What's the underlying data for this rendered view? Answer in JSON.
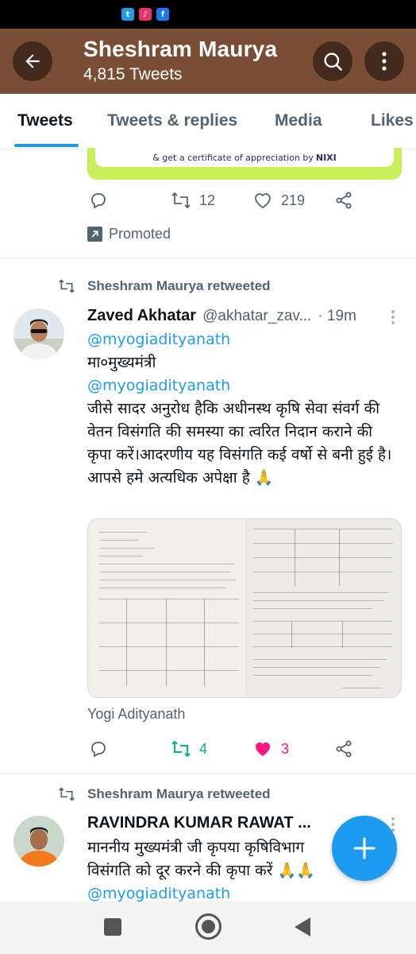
{
  "status_bar": {
    "icons": [
      "twitter-icon",
      "tiktok-icon",
      "facebook-icon"
    ]
  },
  "header": {
    "name": "Sheshram Maurya",
    "tweet_count": "4,815 Tweets",
    "color": "#7a4e35"
  },
  "tabs": [
    {
      "label": "Tweets",
      "active": true
    },
    {
      "label": "Tweets & replies",
      "active": false
    },
    {
      "label": "Media",
      "active": false
    },
    {
      "label": "Likes",
      "active": false
    }
  ],
  "promoted_tweet": {
    "card_text": "& get a certificate of appreciation by",
    "card_brand": "NIXI",
    "retweets": "12",
    "likes": "219",
    "promoted_label": "Promoted"
  },
  "tweet1": {
    "retweeted_by": "Sheshram Maurya retweeted",
    "name": "Zaved Akhatar",
    "handle": "@akhatar_zav...",
    "time": "· 19m",
    "mention1": "@myogiadityanath",
    "line1": "मा०मुख्यमंत्री",
    "mention2": "@myogiadityanath",
    "text": "जीसे सादर अनुरोध हैकि अधीनस्थ कृषि सेवा संवर्ग की वेतन विसंगति की समस्या का त्वरित निदान कराने की कृपा करें।आदरणीय यह विसंगति कई वर्षो से बनी हुई है।आपसे हमे अत्यधिक अपेक्षा है 🙏",
    "tagged": "Yogi Adityanath",
    "retweets": "4",
    "likes": "3"
  },
  "tweet2": {
    "retweeted_by": "Sheshram Maurya retweeted",
    "name": "RAVINDRA KUMAR RAWAT ...",
    "text": "माननीय मुख्यमंत्री जी कृपया कृषिविभाग",
    "text2": "विसंगति को दूर करने की कृपा करें 🙏🙏",
    "mention": "@myogiadityanath"
  },
  "colors": {
    "accent": "#1d9bf0",
    "retweet_active": "#00ba7c",
    "like_active": "#f91880",
    "muted": "#536471"
  }
}
